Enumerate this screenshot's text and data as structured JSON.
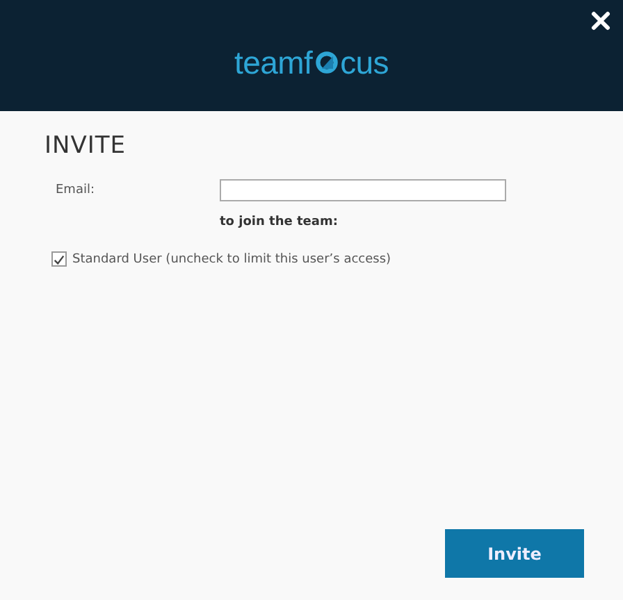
{
  "header": {
    "logo": {
      "before": "teamf",
      "after": "cus"
    }
  },
  "title": "INVITE",
  "email": {
    "label": "Email:"
  },
  "note": "to join the team:",
  "standard_user": {
    "label": "Standard User (uncheck to limit this user’s access)",
    "checked": true
  },
  "button": "Invite"
}
